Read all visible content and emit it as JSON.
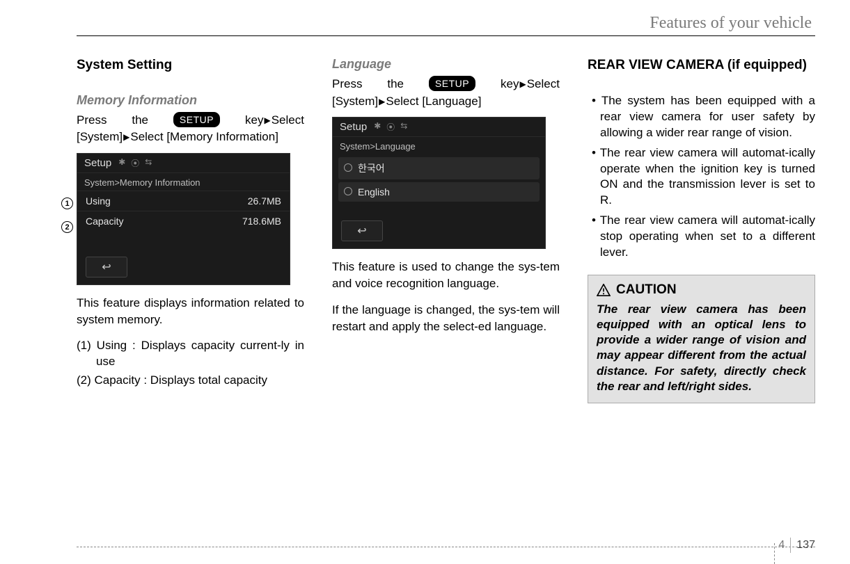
{
  "chapter": "Features of your vehicle",
  "page": {
    "section": "4",
    "number": "137"
  },
  "col1": {
    "title": "System Setting",
    "subtitle": "Memory Information",
    "instr": {
      "w1": "Press",
      "w2": "the",
      "key": "SETUP",
      "w3": "key",
      "w4": "Select",
      "line2a": "[System]",
      "line2b": "Select [Memory Information]"
    },
    "shot": {
      "title": "Setup",
      "crumb": "System>Memory Information",
      "row1_label": "Using",
      "row1_val": "26.7MB",
      "row2_label": "Capacity",
      "row2_val": "718.6MB",
      "back": "↩"
    },
    "callout1": "1",
    "callout2": "2",
    "body": "This feature displays information related to system memory.",
    "li1": "(1) Using : Displays capacity current-ly in use",
    "li2": "(2) Capacity : Displays total capacity"
  },
  "col2": {
    "subtitle": "Language",
    "instr": {
      "w1": "Press",
      "w2": "the",
      "key": "SETUP",
      "w3": "key",
      "w4": "Select",
      "line2a": "[System]",
      "line2b": "Select [Language]"
    },
    "shot": {
      "title": "Setup",
      "crumb": "System>Language",
      "row1_label": "한국어",
      "row2_label": "English",
      "back": "↩"
    },
    "body1": "This feature is used to change the sys-tem and voice recognition language.",
    "body2": "If the language is changed, the sys-tem will restart and apply the select-ed language."
  },
  "col3": {
    "title": "REAR VIEW CAMERA (if equipped)",
    "b1": "The system has been equipped with a rear view camera for user safety by allowing a wider rear range of vision.",
    "b2": "The rear view camera will automat-ically operate when the ignition key is turned ON and the transmission lever is set to R.",
    "b3": "The rear view camera will automat-ically stop operating when set to a different lever.",
    "caution_title": "CAUTION",
    "caution_body": "The rear view camera has been equipped with an optical lens to provide a wider range of vision and may appear different from the actual distance. For safety, directly check the rear and left/right sides."
  }
}
